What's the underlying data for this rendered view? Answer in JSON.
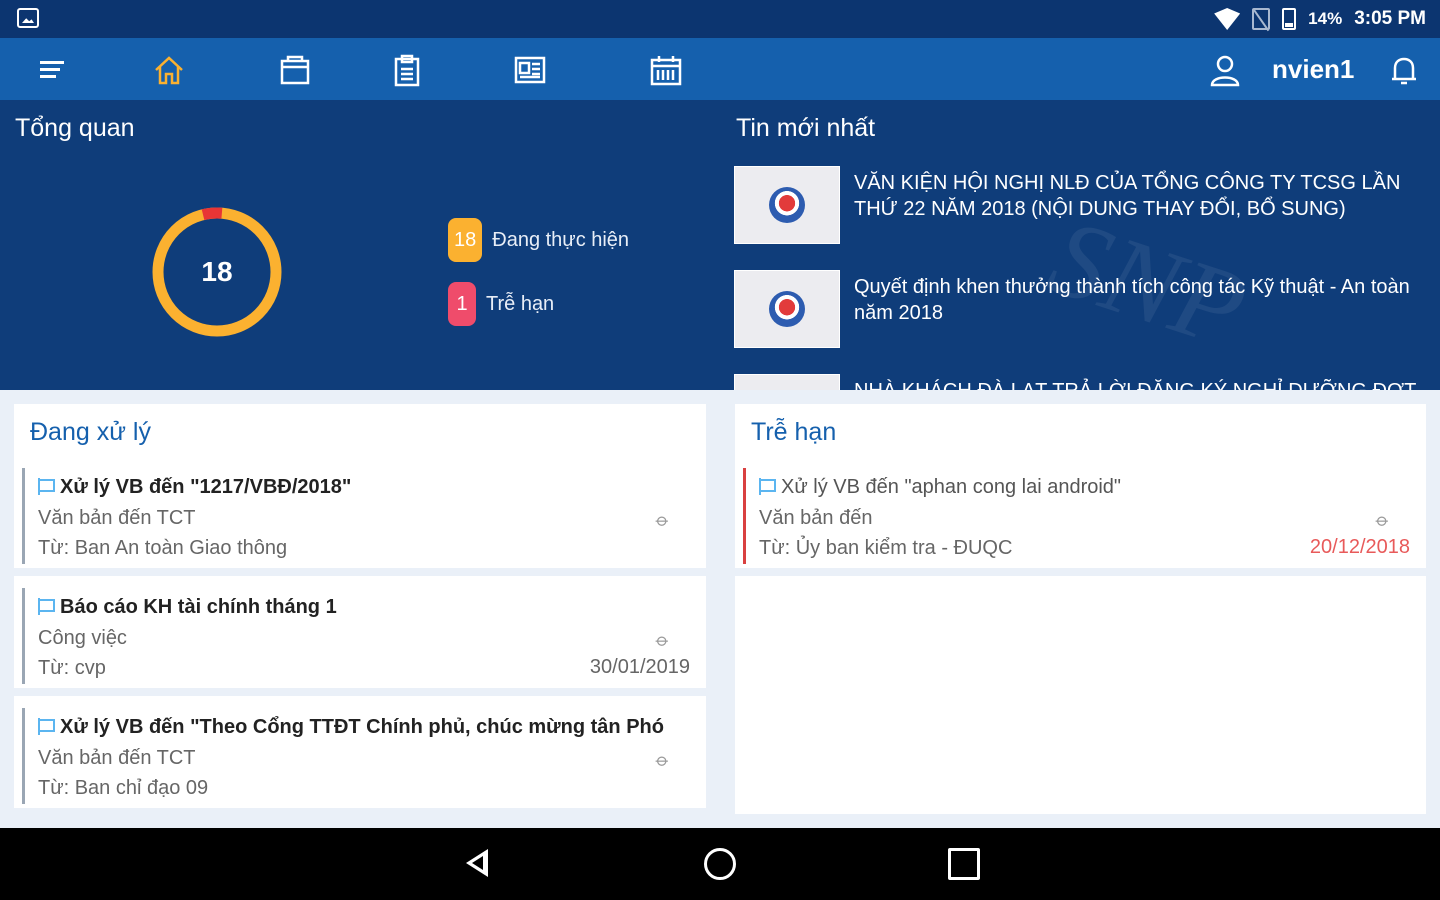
{
  "status_bar": {
    "battery": "14%",
    "time": "3:05 PM"
  },
  "nav": {
    "icons": [
      "menu-icon",
      "home-icon",
      "folder-icon",
      "clipboard-icon",
      "document-icon",
      "calendar-icon"
    ],
    "username": "nvien1"
  },
  "overview": {
    "title": "Tổng quan",
    "total": "18",
    "legend": [
      {
        "count": "18",
        "label": "Đang thực hiện",
        "color": "#fbb130"
      },
      {
        "count": "1",
        "label": "Trễ hạn",
        "color": "#ef4c6b"
      }
    ]
  },
  "news": {
    "title": "Tin mới nhất",
    "items": [
      {
        "title": "VĂN KIỆN HỘI NGHỊ NLĐ CỦA TỔNG CÔNG TY TCSG LẦN THỨ 22 NĂM 2018 (NỘI DUNG THAY ĐỔI, BỔ SUNG)"
      },
      {
        "title": "Quyết định khen thưởng thành tích công tác Kỹ thuật - An toàn năm 2018"
      },
      {
        "title": "NHÀ KHÁCH ĐÀ LẠT TRẢ LỜI ĐĂNG KÝ NGHỈ DƯỠNG ĐỢT"
      }
    ]
  },
  "processing": {
    "title": "Đang xử lý",
    "items": [
      {
        "title": "Xử lý VB đến \"1217/VBĐ/2018\"",
        "type": "Văn bản đến TCT",
        "from": "Từ: Ban An toàn Giao thông",
        "date": ""
      },
      {
        "title": "Báo cáo KH tài chính tháng 1",
        "type": "Công việc",
        "from": "Từ: cvp",
        "date": "30/01/2019"
      },
      {
        "title": "Xử lý VB đến \"Theo Cổng TTĐT Chính phủ, chúc mừng tân Phó",
        "type": "Văn bản đến TCT",
        "from": "Từ: Ban chỉ đạo 09",
        "date": ""
      }
    ]
  },
  "overdue": {
    "title": "Trễ hạn",
    "items": [
      {
        "title": "Xử lý VB đến \"aphan cong lai android\"",
        "type": "Văn bản đến",
        "from": "Từ: Ủy ban kiểm tra - ĐUQC",
        "date": "20/12/2018"
      }
    ]
  },
  "colors": {
    "header": "#1560ad",
    "background": "#0f3d7a",
    "accent_orange": "#fbb130",
    "accent_red": "#ef4c6b"
  }
}
